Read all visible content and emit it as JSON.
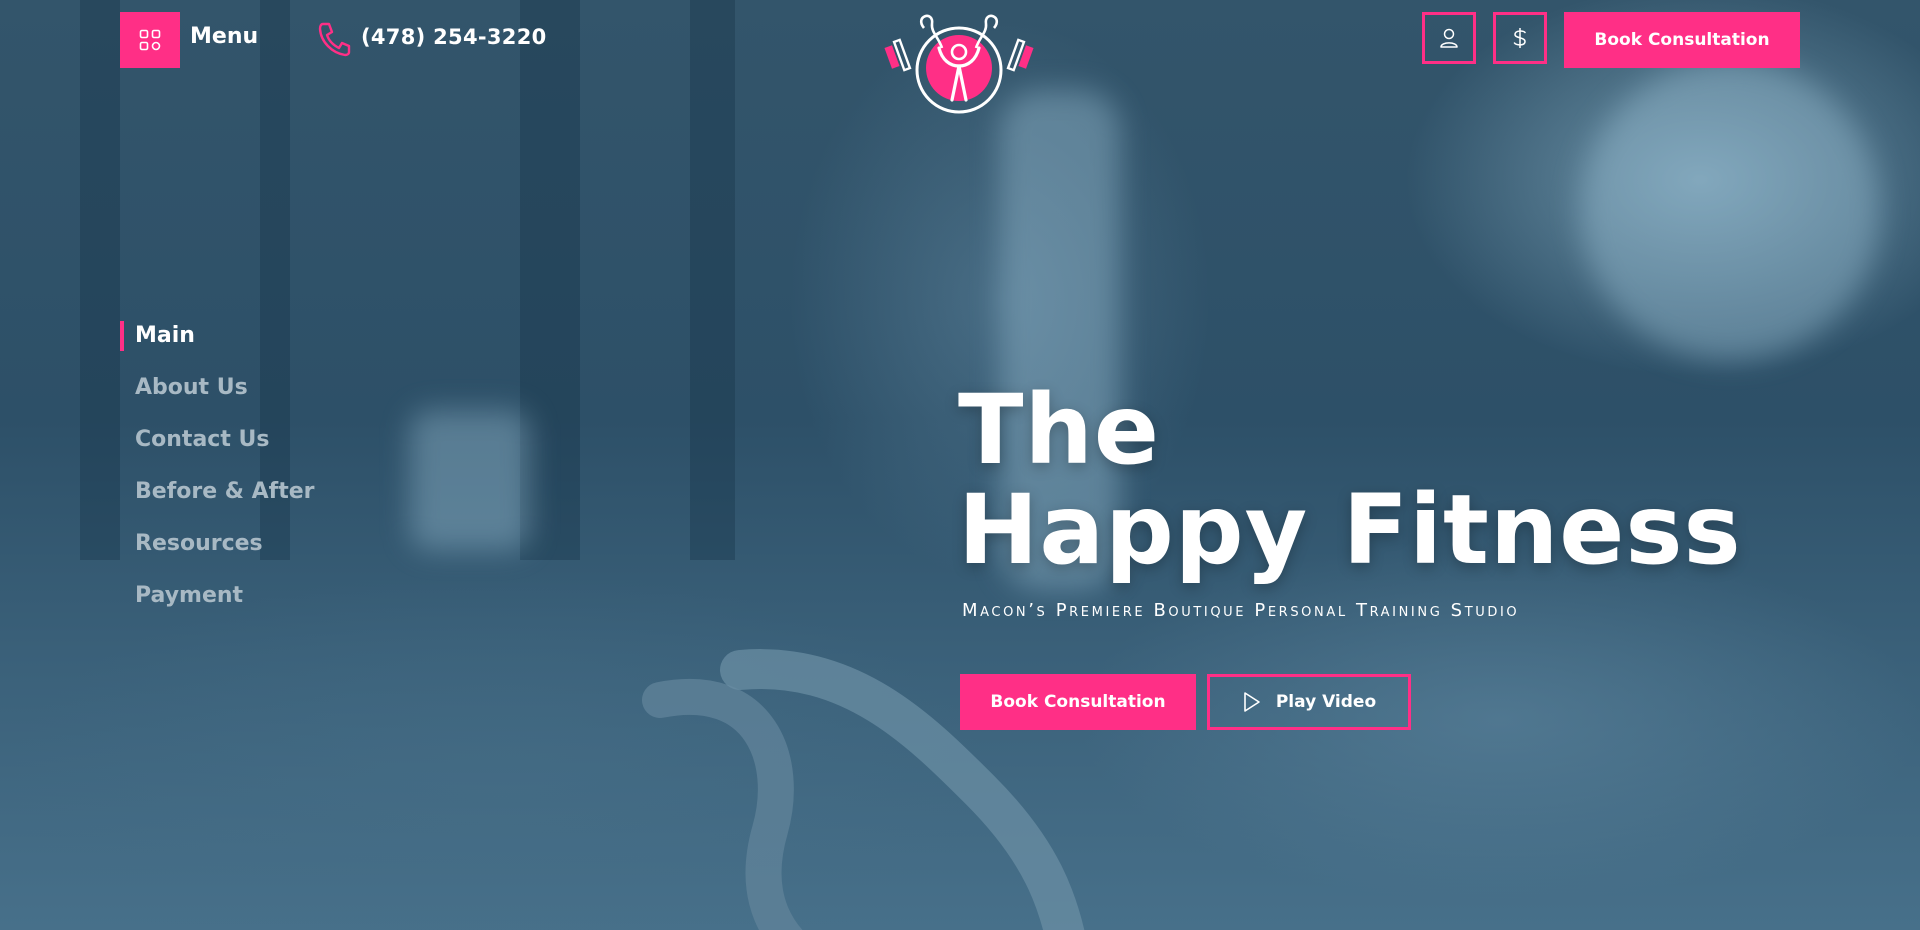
{
  "colors": {
    "accent": "#ff2f86",
    "overlay": "#2a4d63"
  },
  "header": {
    "menu_label": "Menu",
    "menu_icon": "grid-icon",
    "phone_icon": "phone-icon",
    "phone": "(478) 254-3220",
    "logo_icon": "happy-fitness-logo",
    "account_icon": "user-icon",
    "pricing_icon": "dollar-icon",
    "cta_label": "Book Consultation"
  },
  "side_nav": {
    "items": [
      {
        "label": "Main",
        "active": true
      },
      {
        "label": "About Us",
        "active": false
      },
      {
        "label": "Contact Us",
        "active": false
      },
      {
        "label": "Before & After",
        "active": false
      },
      {
        "label": "Resources",
        "active": false
      },
      {
        "label": "Payment",
        "active": false
      }
    ]
  },
  "hero": {
    "title_line1": "The",
    "title_line2": "Happy Fitness",
    "subtitle": "Macon’s Premiere Boutique Personal Training Studio",
    "cta_label": "Book Consultation",
    "video_label": "Play Video",
    "video_icon": "play-icon"
  }
}
